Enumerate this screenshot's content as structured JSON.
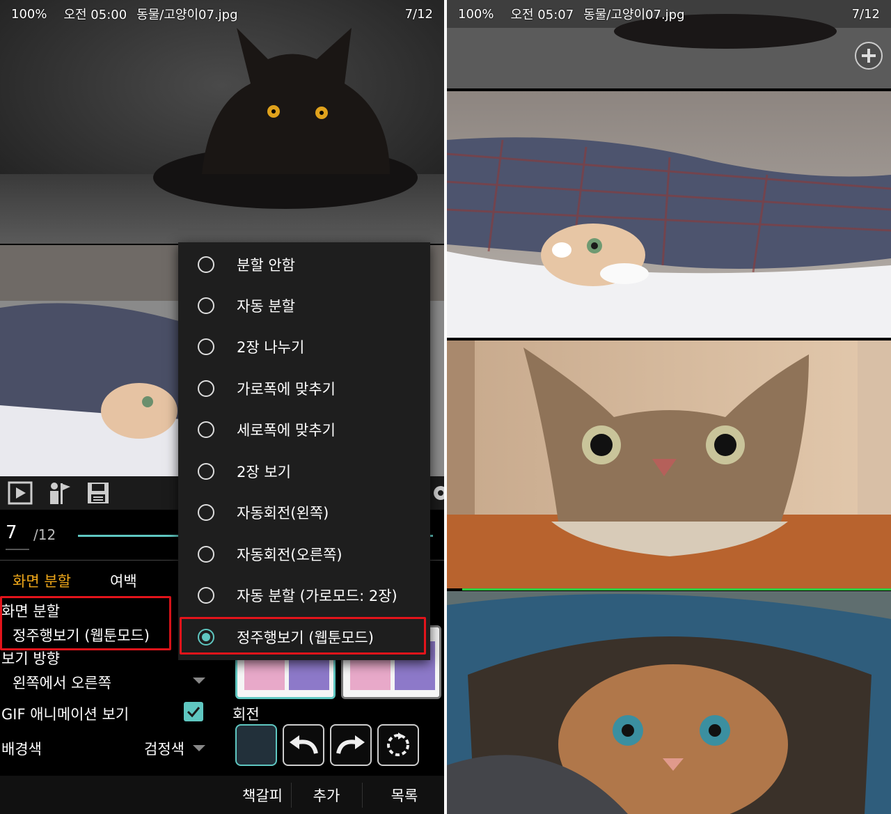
{
  "left": {
    "status": {
      "battery": "100%",
      "time": "오전 05:00",
      "file": "동물/고양이07.jpg",
      "page": "7/12"
    },
    "page_current": "7",
    "page_total": "/12",
    "tabs": [
      "화면 분할",
      "여백"
    ],
    "settings": {
      "split_label": "화면 분할",
      "split_value": "정주행보기 (웹툰모드)",
      "direction_label": "보기 방향",
      "direction_value": "왼쪽에서 오른쪽",
      "gif_label": "GIF 애니메이션 보기",
      "gif_checked": true,
      "bg_label": "배경색",
      "bg_value": "검정색",
      "rotate_label": "회전"
    },
    "bottom": {
      "bookmark": "책갈피",
      "add": "추가",
      "list": "목록"
    },
    "menu": {
      "items": [
        "분할 안함",
        "자동 분할",
        "2장 나누기",
        "가로폭에 맞추기",
        "세로폭에 맞추기",
        "2장 보기",
        "자동회전(왼쪽)",
        "자동회전(오른쪽)",
        "자동 분할 (가로모드: 2장)",
        "정주행보기 (웹툰모드)"
      ],
      "selected_index": 9
    }
  },
  "right": {
    "status": {
      "battery": "100%",
      "time": "오전 05:07",
      "file": "동물/고양이07.jpg",
      "page": "7/12"
    }
  },
  "colors": {
    "accent": "#5fc7c1",
    "tab_active": "#f0a81a",
    "highlight": "#e3141b"
  },
  "icons": [
    "play-icon",
    "bookmark-flag-icon",
    "save-icon",
    "settings-gear-icon",
    "zoom-plus-icon",
    "rotate-left-icon",
    "rotate-right-icon",
    "rotate-auto-icon",
    "check-icon"
  ]
}
